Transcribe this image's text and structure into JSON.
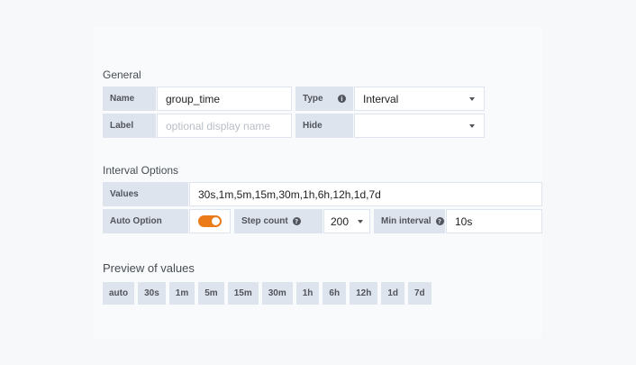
{
  "general": {
    "title": "General",
    "name_label": "Name",
    "name_value": "group_time",
    "type_label": "Type",
    "type_value": "Interval",
    "label_label": "Label",
    "label_placeholder": "optional display name",
    "hide_label": "Hide",
    "hide_value": ""
  },
  "interval_options": {
    "title": "Interval Options",
    "values_label": "Values",
    "values_value": "30s,1m,5m,15m,30m,1h,6h,12h,1d,7d",
    "auto_option_label": "Auto Option",
    "auto_option_on": true,
    "step_count_label": "Step count",
    "step_count_value": "200",
    "min_interval_label": "Min interval",
    "min_interval_value": "10s"
  },
  "preview": {
    "title": "Preview of values",
    "chips": [
      "auto",
      "30s",
      "1m",
      "5m",
      "15m",
      "30m",
      "1h",
      "6h",
      "12h",
      "1d",
      "7d"
    ]
  },
  "colors": {
    "accent_toggle": "#eb7b18",
    "label_bg": "#dde4ed",
    "page_bg": "#f7f8fa"
  },
  "icons": {
    "type_info": "info-icon",
    "step_count_help": "question-icon",
    "min_interval_help": "question-icon",
    "dropdown": "chevron-down-icon"
  }
}
